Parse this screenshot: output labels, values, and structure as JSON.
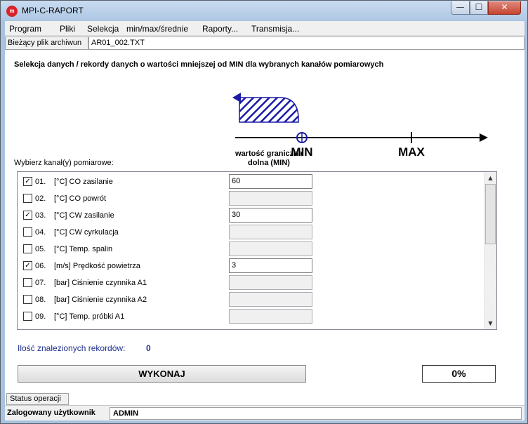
{
  "window": {
    "title": "MPI-C-RAPORT",
    "icon_text": "m",
    "controls": {
      "minimize": "—",
      "maximize": "☐",
      "close": "✕"
    }
  },
  "menu": {
    "items": [
      {
        "label": "Program"
      },
      {
        "label": "Pliki"
      },
      {
        "label": "Selekcja"
      },
      {
        "label": "min/max/średnie"
      },
      {
        "label": "Raporty..."
      },
      {
        "label": "Transmisja..."
      }
    ]
  },
  "archive": {
    "label": "Bieżący plik archiwun",
    "value": "AR01_002.TXT"
  },
  "heading": "Selekcja danych / rekordy danych o wartości mniejszej od MIN dla wybranych kanałów pomiarowych",
  "diagram": {
    "min_label": "MIN",
    "max_label": "MAX",
    "accent_color": "#1a1aa6"
  },
  "channels": {
    "choose_label": "Wybierz kanał(y) pomiarowe:",
    "column_header": "wartość graniczna dolna (MIN)",
    "rows": [
      {
        "number": "01.",
        "name": "[°C] CO zasilanie",
        "checked": true,
        "check_mark": "✓",
        "value": "60"
      },
      {
        "number": "02.",
        "name": "[°C] CO powrót",
        "checked": false,
        "check_mark": "",
        "value": ""
      },
      {
        "number": "03.",
        "name": "[°C] CW zasilanie",
        "checked": true,
        "check_mark": "✓",
        "value": "30"
      },
      {
        "number": "04.",
        "name": "[°C] CW cyrkulacja",
        "checked": false,
        "check_mark": "",
        "value": ""
      },
      {
        "number": "05.",
        "name": "[°C] Temp. spalin",
        "checked": false,
        "check_mark": "",
        "value": ""
      },
      {
        "number": "06.",
        "name": "[m/s] Prędkość powietrza",
        "checked": true,
        "check_mark": "✓",
        "value": "3"
      },
      {
        "number": "07.",
        "name": "[bar] Ciśnienie czynnika A1",
        "checked": false,
        "check_mark": "",
        "value": ""
      },
      {
        "number": "08.",
        "name": "[bar] Ciśnienie czynnika A2",
        "checked": false,
        "check_mark": "",
        "value": ""
      },
      {
        "number": "09.",
        "name": "[°C] Temp. próbki A1",
        "checked": false,
        "check_mark": "",
        "value": ""
      }
    ],
    "scroll_up": "▲",
    "scroll_down": "▼"
  },
  "results": {
    "found_label": "Ilość znalezionych rekordów:",
    "found_value": "0"
  },
  "actions": {
    "execute_label": "WYKONAJ",
    "progress": "0%"
  },
  "status": {
    "tab_label": "Status operacji",
    "user_label": "Zalogowany użytkownik",
    "user_value": "ADMIN"
  }
}
